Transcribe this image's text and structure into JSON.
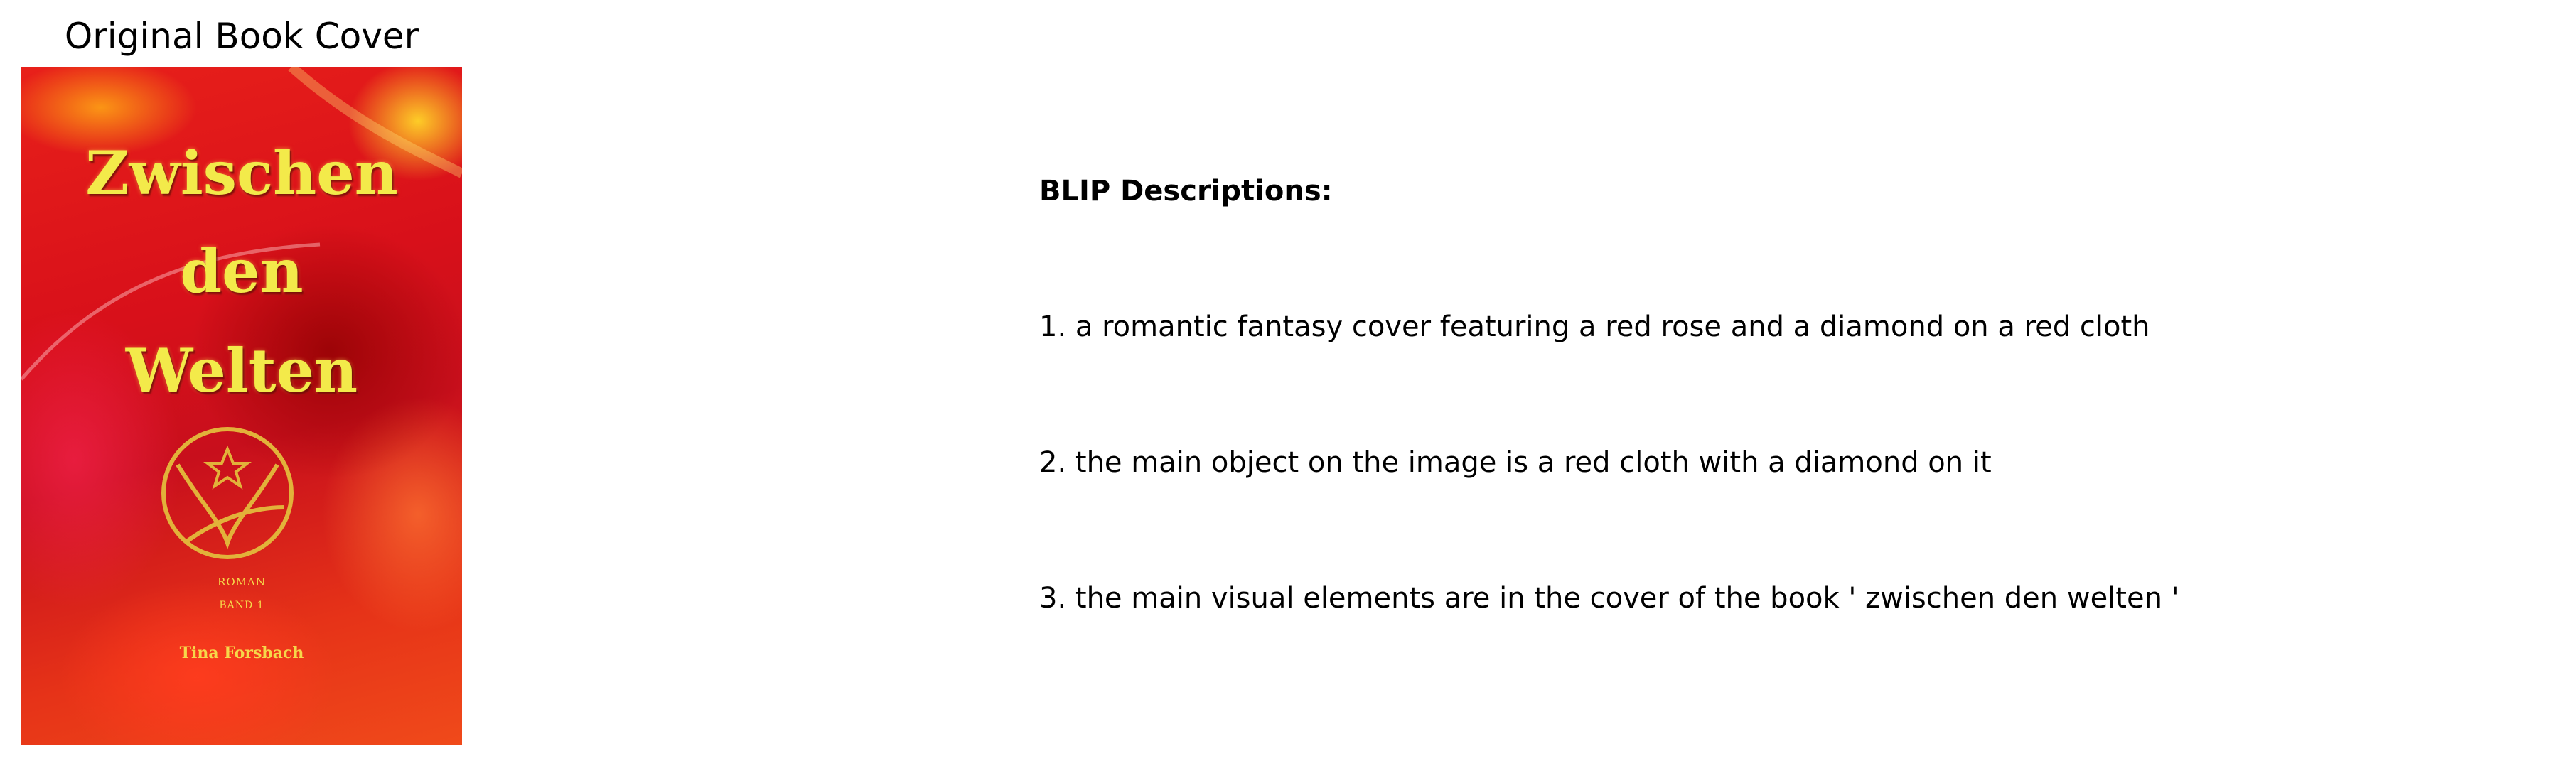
{
  "panel_title": "Original Book Cover",
  "cover": {
    "title_lines": [
      "Zwischen",
      "den",
      "Welten"
    ],
    "genre": "ROMAN",
    "volume": "BAND 1",
    "author": "Tina Forsbach"
  },
  "descriptions": {
    "heading": "BLIP Descriptions:",
    "items": [
      "1. a romantic fantasy cover featuring a red rose and a diamond on a red cloth",
      "2. the main object on the image is a red cloth with a diamond on it",
      "3. the main visual elements are in the cover of the book ' zwischen den welten '"
    ]
  },
  "colors": {
    "cover_red": "#d8101a",
    "cover_title_yellow": "#f3ea4a",
    "emblem_gold": "#e2b23a"
  }
}
